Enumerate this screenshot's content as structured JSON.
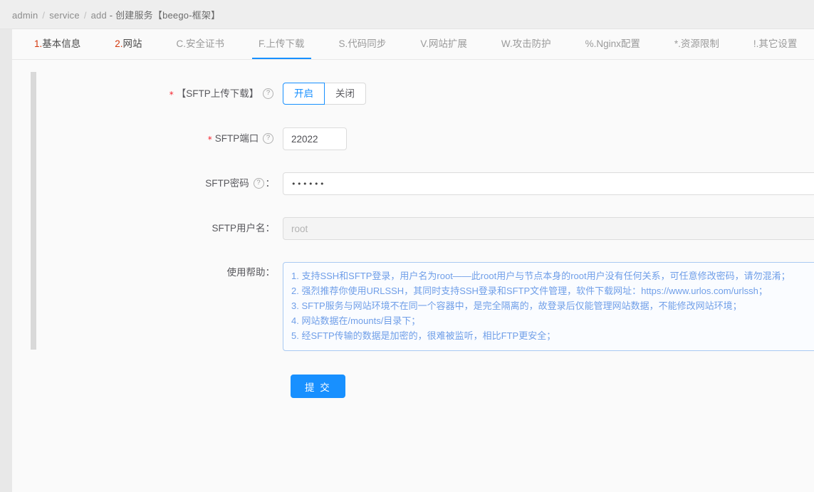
{
  "breadcrumb": {
    "items": [
      "admin",
      "service",
      "add"
    ],
    "separator": "/",
    "title": "- 创建服务【beego-框架】",
    "full": "admin / service / add - 创建服务【beego-框架】"
  },
  "tabs": [
    {
      "prefix": "1.",
      "label": "基本信息",
      "active": false,
      "strong": true
    },
    {
      "prefix": "2.",
      "label": "网站",
      "active": false,
      "strong": true
    },
    {
      "prefix": "",
      "label": "C.安全证书",
      "active": false,
      "strong": false
    },
    {
      "prefix": "",
      "label": "F.上传下载",
      "active": true,
      "strong": false
    },
    {
      "prefix": "",
      "label": "S.代码同步",
      "active": false,
      "strong": false
    },
    {
      "prefix": "",
      "label": "V.网站扩展",
      "active": false,
      "strong": false
    },
    {
      "prefix": "",
      "label": "W.攻击防护",
      "active": false,
      "strong": false
    },
    {
      "prefix": "",
      "label": "%.Nginx配置",
      "active": false,
      "strong": false
    },
    {
      "prefix": "",
      "label": "*.资源限制",
      "active": false,
      "strong": false
    },
    {
      "prefix": "",
      "label": "!.其它设置",
      "active": false,
      "strong": false
    }
  ],
  "form": {
    "sftp_toggle": {
      "label": "【SFTP上传下载】",
      "required": true,
      "help_icon": "question-circle-icon",
      "options": [
        "开启",
        "关闭"
      ],
      "value": "开启"
    },
    "sftp_port": {
      "label": "SFTP端口",
      "required": true,
      "help_icon": "question-circle-icon",
      "value": "22022",
      "placeholder": ""
    },
    "sftp_password": {
      "label": "SFTP密码",
      "required": false,
      "help_icon": "question-circle-icon",
      "suffix": "：",
      "value": "••••••",
      "placeholder": ""
    },
    "sftp_username": {
      "label": "SFTP用户名",
      "required": false,
      "suffix": "：",
      "value": "",
      "placeholder": "root",
      "disabled": true
    },
    "usage_help": {
      "label": "使用帮助",
      "suffix": "：",
      "lines": [
        "1. 支持SSH和SFTP登录，用户名为root——此root用户与节点本身的root用户没有任何关系，可任意修改密码，请勿混淆；",
        "2. 强烈推荐你使用URLSSH，其同时支持SSH登录和SFTP文件管理，软件下载网址：https://www.urlos.com/urlssh；",
        "3. SFTP服务与网站环境不在同一个容器中，是完全隔离的，故登录后仅能管理网站数据，不能修改网站环境；",
        "4. 网站数据在/mounts/目录下；",
        "5. 经SFTP传输的数据是加密的，很难被监听，相比FTP更安全；"
      ]
    },
    "submit": {
      "label": "提 交"
    }
  },
  "colors": {
    "accent": "#1890ff",
    "required": "#f5222d",
    "tab_number": "#d4380d",
    "help_text": "#6f9ee8",
    "help_border": "#a9c9f2",
    "page_bg": "#e8e8e8",
    "panel_bg": "#fafafa"
  }
}
